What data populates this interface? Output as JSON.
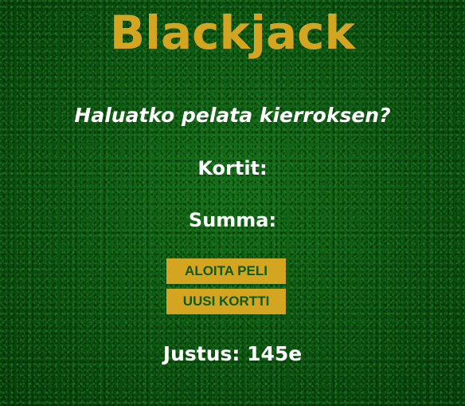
{
  "title": "Blackjack",
  "prompt": "Haluatko pelata kierroksen?",
  "cards_label": "Kortit:",
  "sum_label": "Summa:",
  "buttons": {
    "start_game": "ALOITA PELI",
    "new_card": "UUSI KORTTI"
  },
  "player_info": "Justus: 145e",
  "colors": {
    "table_green": "#0d5a12",
    "gold": "#d4a520",
    "text_white": "#ffffff"
  }
}
